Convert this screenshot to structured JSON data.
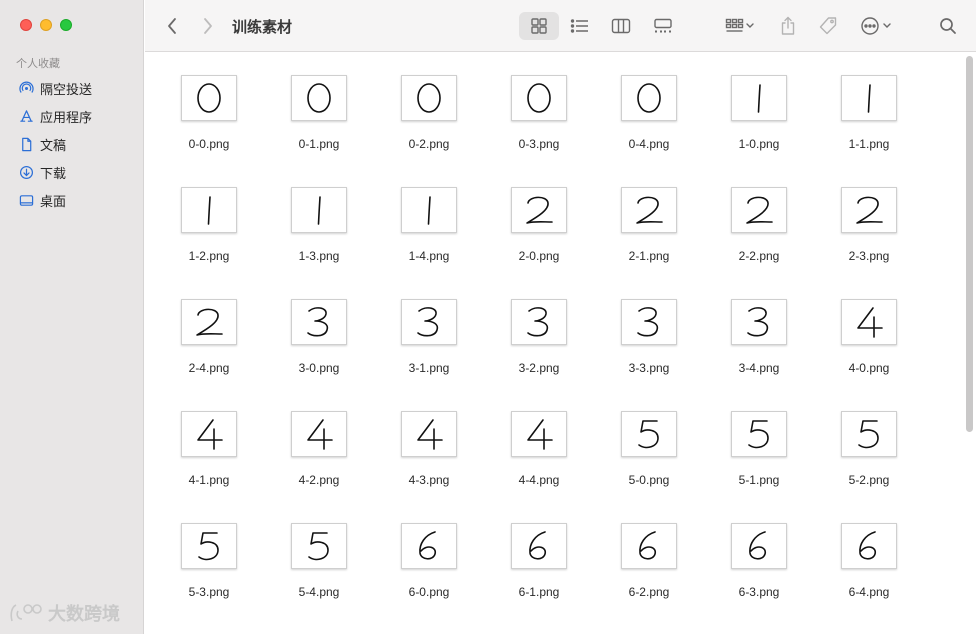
{
  "window": {
    "title": "训练素材"
  },
  "sidebar": {
    "section_label": "个人收藏",
    "items": [
      {
        "label": "隔空投送",
        "icon": "airdrop-icon"
      },
      {
        "label": "应用程序",
        "icon": "applications-icon"
      },
      {
        "label": "文稿",
        "icon": "document-icon"
      },
      {
        "label": "下载",
        "icon": "download-icon"
      },
      {
        "label": "桌面",
        "icon": "desktop-icon"
      }
    ]
  },
  "toolbar": {
    "back": "chevron-left-icon",
    "forward": "chevron-right-icon",
    "views": [
      "icon-view-icon",
      "list-view-icon",
      "column-view-icon",
      "gallery-view-icon"
    ],
    "active_view": "icon-view-icon"
  },
  "files": [
    {
      "name": "0-0.png",
      "digit": "0"
    },
    {
      "name": "0-1.png",
      "digit": "0"
    },
    {
      "name": "0-2.png",
      "digit": "0"
    },
    {
      "name": "0-3.png",
      "digit": "0"
    },
    {
      "name": "0-4.png",
      "digit": "0"
    },
    {
      "name": "1-0.png",
      "digit": "1"
    },
    {
      "name": "1-1.png",
      "digit": "1"
    },
    {
      "name": "1-2.png",
      "digit": "1"
    },
    {
      "name": "1-3.png",
      "digit": "1"
    },
    {
      "name": "1-4.png",
      "digit": "1"
    },
    {
      "name": "2-0.png",
      "digit": "2"
    },
    {
      "name": "2-1.png",
      "digit": "2"
    },
    {
      "name": "2-2.png",
      "digit": "2"
    },
    {
      "name": "2-3.png",
      "digit": "2"
    },
    {
      "name": "2-4.png",
      "digit": "2"
    },
    {
      "name": "3-0.png",
      "digit": "3"
    },
    {
      "name": "3-1.png",
      "digit": "3"
    },
    {
      "name": "3-2.png",
      "digit": "3"
    },
    {
      "name": "3-3.png",
      "digit": "3"
    },
    {
      "name": "3-4.png",
      "digit": "3"
    },
    {
      "name": "4-0.png",
      "digit": "4"
    },
    {
      "name": "4-1.png",
      "digit": "4"
    },
    {
      "name": "4-2.png",
      "digit": "4"
    },
    {
      "name": "4-3.png",
      "digit": "4"
    },
    {
      "name": "4-4.png",
      "digit": "4"
    },
    {
      "name": "5-0.png",
      "digit": "5"
    },
    {
      "name": "5-1.png",
      "digit": "5"
    },
    {
      "name": "5-2.png",
      "digit": "5"
    },
    {
      "name": "5-3.png",
      "digit": "5"
    },
    {
      "name": "5-4.png",
      "digit": "5"
    },
    {
      "name": "6-0.png",
      "digit": "6"
    },
    {
      "name": "6-1.png",
      "digit": "6"
    },
    {
      "name": "6-2.png",
      "digit": "6"
    },
    {
      "name": "6-3.png",
      "digit": "6"
    },
    {
      "name": "6-4.png",
      "digit": "6"
    }
  ],
  "watermark": {
    "text": "大数跨境"
  },
  "colors": {
    "close": "#fe5f57",
    "minimize": "#febc2e",
    "zoom": "#28c840",
    "accent": "#2c6fd6"
  }
}
